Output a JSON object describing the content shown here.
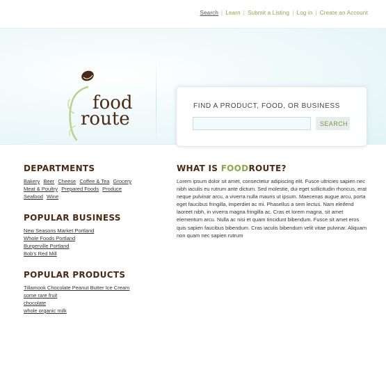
{
  "nav": {
    "items": [
      {
        "label": "Search",
        "active": true
      },
      {
        "label": "Learn"
      },
      {
        "label": "Submit a Listing"
      },
      {
        "label": "Log in"
      },
      {
        "label": "Create an Account"
      }
    ]
  },
  "logo": {
    "line1": "food",
    "line2": "route",
    "icon": "sprout-icon"
  },
  "search": {
    "title": "FIND A PRODUCT, FOOD, OR BUSINESS",
    "placeholder": "",
    "button": "SEARCH"
  },
  "departments": {
    "title": "DEPARTMENTS",
    "items": [
      "Bakery",
      "Beer",
      "Cheese",
      "Coffee & Tea",
      "Grocery",
      "Meat & Poultry",
      "Prepared Foods",
      "Produce",
      "Seafood",
      "Wine"
    ]
  },
  "popular_business": {
    "title": "POPULAR BUSINESS",
    "items": [
      "New Seasons Market Portland",
      "Whole Foods Portland",
      "Burgerville Portland",
      "Bob's Red Mill"
    ]
  },
  "popular_products": {
    "title": "POPULAR PRODUCTS",
    "items": [
      "Tillamook Chocolate Peanut Butter Ice Cream",
      "some rare fruit",
      "chocolate",
      "whole organic milk"
    ]
  },
  "about": {
    "title_prefix": "WHAT IS ",
    "title_brand": "FOOD",
    "title_suffix": "ROUTE?",
    "body": "Lorem ipsum dolor sit amet, consectetur adipiscing elit. Fusce ultricies sapien nec nibh iaculis eu rutrum ante dictum. Sed molestie, dui eget sollicitudin rhoncus, erat neque pulvinar arcu, a viverra nulla mauris ut ipsum. Maecenas augue arcu, porta eget faucibus fringilla, imperdiet ac mi. Phasellus a sem lectus. Nam eleifend laoreet nibh, in viverra magna fringilla ac. Cras et lorem magna, sit amet elementum arcu. Nulla ac nisi et quam tincidunt bibendum. Fusce sit amet eros quis sapien faucibus bibendum. Cras iaculis bibendum velit vitae pulvinar. Aliquam non quam nec sapien rutrum"
  },
  "colors": {
    "brand_brown": "#4a2a12",
    "brand_green": "#8aa84a",
    "hero_bg": "#e2f3f6"
  }
}
